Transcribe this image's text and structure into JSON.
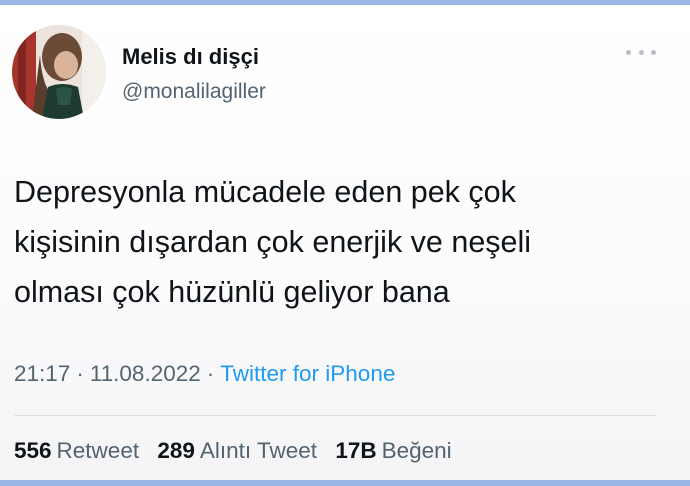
{
  "user": {
    "display_name": "Melis dı dişçi",
    "handle": "@monalilagiller"
  },
  "tweet": {
    "lines": [
      "Depresyonla mücadele eden pek çok",
      "kişisinin dışardan çok enerjik ve neşeli",
      "olması çok hüzünlü geliyor bana"
    ],
    "time": "21:17",
    "separator": "·",
    "date": "11.08.2022",
    "source": "Twitter for iPhone"
  },
  "stats": {
    "retweets_count": "556",
    "retweets_label": "Retweet",
    "quotes_count": "289",
    "quotes_label": "Alıntı Tweet",
    "likes_count": "17B",
    "likes_label": "Beğeni"
  },
  "icons": {
    "more": "more-horizontal-icon"
  },
  "colors": {
    "text": "#0f1419",
    "secondary": "#536471",
    "link": "#1d9bf0",
    "frame": "#9cb6e8"
  }
}
